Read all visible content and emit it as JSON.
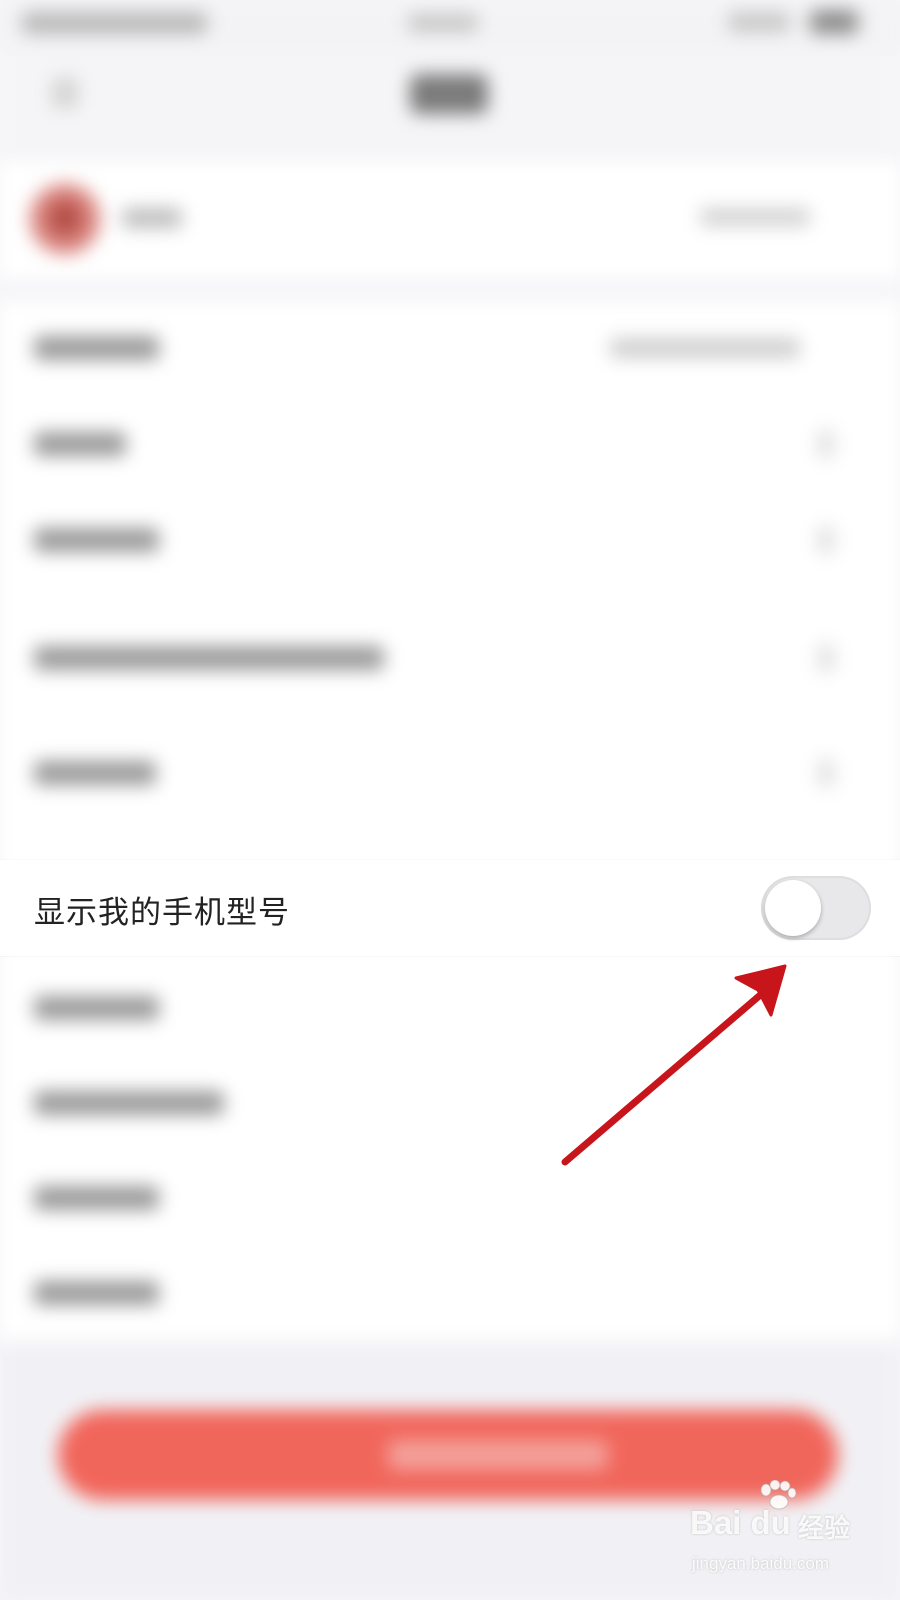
{
  "setting": {
    "label": "显示我的手机型号",
    "toggle_on": false
  },
  "colors": {
    "toggle_track_off": "#e8e8ea",
    "toggle_knob": "#ffffff",
    "logout_button": "#f1665b",
    "annotation_arrow": "#c8151b",
    "avatar": "#d8807a"
  },
  "watermark": {
    "brand": "Bai du",
    "jingyan": "经验",
    "url": "jingyan.baidu.com"
  }
}
